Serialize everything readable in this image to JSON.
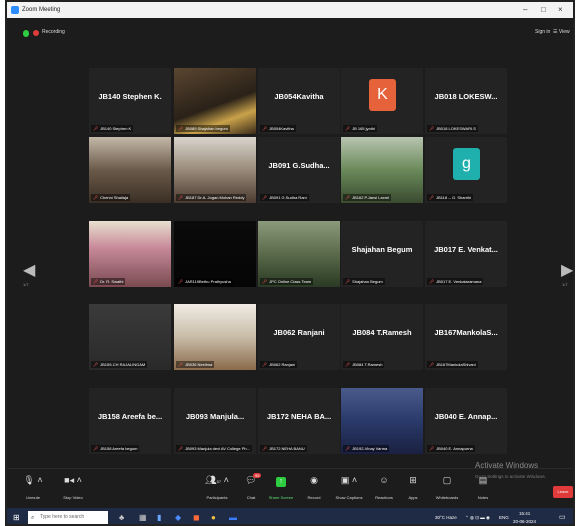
{
  "window": {
    "title": "Zoom Meeting",
    "minimize": "–",
    "maximize": "□",
    "close": "×"
  },
  "meeting": {
    "recording_label": "Recording",
    "sign_in": "Sign in",
    "view": "☰ View",
    "page_left": "1/7",
    "page_right": "1/7"
  },
  "tiles": [
    {
      "name": "JB140 Stephen K.",
      "label": "JB140 Stephen K",
      "type": "name"
    },
    {
      "name": "",
      "label": "JB089 Shajahan begum",
      "type": "video"
    },
    {
      "name": "JB054Kavitha",
      "label": "JB054Kavitha",
      "type": "name"
    },
    {
      "name": "K",
      "label": "JB 165 jyothi",
      "type": "avatar",
      "color": "#e5623a"
    },
    {
      "name": "JB018 LOKESW...",
      "label": "JB018 LOKESWARI.S",
      "type": "name"
    },
    {
      "name": "",
      "label": "Chenni Shailaja",
      "type": "video"
    },
    {
      "name": "",
      "label": "JB187 Dr.A. Jogan Mohan Reddy",
      "type": "video"
    },
    {
      "name": "JB091 G.Sudha...",
      "label": "JB091 G.Sudha Rani",
      "type": "name"
    },
    {
      "name": "",
      "label": "JB162 P.Jansi Laxmi",
      "type": "video"
    },
    {
      "name": "g",
      "label": "JB118 -- G. Shanthi",
      "type": "avatar",
      "color": "#1fb0ad"
    },
    {
      "name": "",
      "label": "Dr. R. Swathi",
      "type": "video"
    },
    {
      "name": "",
      "label": "JAR119Bethu Prathyusha",
      "type": "video"
    },
    {
      "name": "",
      "label": "JPC Online Class Team",
      "type": "video",
      "active": true
    },
    {
      "name": "Shajahan Begum",
      "label": "Shajahan Begum",
      "type": "name"
    },
    {
      "name": "JB017 E. Venkat...",
      "label": "JB017 E. Venkataramana",
      "type": "name"
    },
    {
      "name": "",
      "label": "JB159-CH RAJALINGAM",
      "type": "video"
    },
    {
      "name": "",
      "label": "JB036 Neelima",
      "type": "video"
    },
    {
      "name": "JB062 Ranjani",
      "label": "JB062 Ranjani",
      "type": "name"
    },
    {
      "name": "JB084 T.Ramesh",
      "label": "JB084 T.Ramesh",
      "type": "name"
    },
    {
      "name": "JB167MankolaS...",
      "label": "JB167MankolaShivani",
      "type": "name"
    },
    {
      "name": "JB158 Areefa be...",
      "label": "JB158 Areefa begum",
      "type": "name"
    },
    {
      "name": "JB093 Manjula...",
      "label": "JB093 Manjula devi AV College Ph...",
      "type": "name"
    },
    {
      "name": "JB172 NEHA BA...",
      "label": "JB172 NEHA BANU",
      "type": "name"
    },
    {
      "name": "",
      "label": "JB192-Vinay Varma",
      "type": "video"
    },
    {
      "name": "JB040 E. Annap...",
      "label": "JB040 E. Annapurna",
      "type": "name"
    }
  ],
  "toolbar": {
    "unmute": "Unmute",
    "stop_video": "Stop Video",
    "participants": "Participants",
    "participants_count": "57",
    "chat": "Chat",
    "chat_badge": "99",
    "share_screen": "Share Screen",
    "record": "Record",
    "show_captions": "Show Captions",
    "reactions": "Reactions",
    "apps": "Apps",
    "whiteboards": "Whiteboards",
    "notes": "Notes",
    "leave": "Leave"
  },
  "watermark": {
    "line1": "Activate Windows",
    "line2": "Go to Settings to activate Windows."
  },
  "taskbar": {
    "search_placeholder": "Type here to search",
    "weather": "30°C Haze",
    "lang": "ENG",
    "time": "15:41",
    "date": "20-06-2024"
  }
}
